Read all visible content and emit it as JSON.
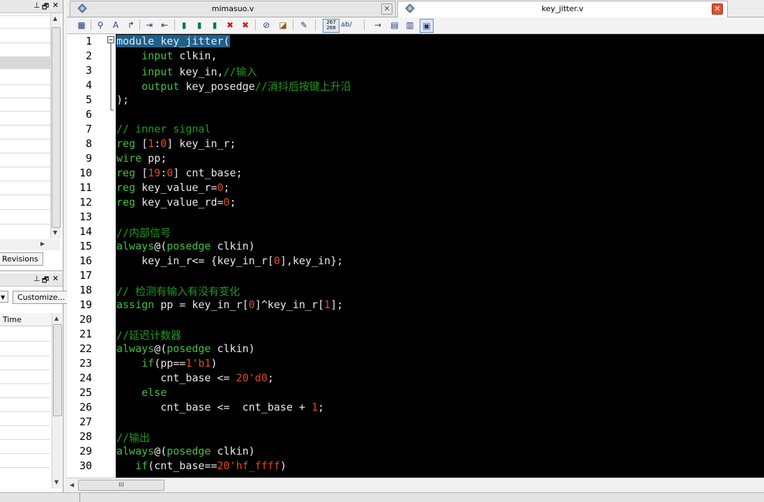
{
  "left_panel": {
    "top_panel_controls": [
      "⊥",
      "🗗",
      "✕"
    ],
    "revisions_tab": "Revisions",
    "mid_panel_controls": [
      "⊥",
      "🗗",
      "✕"
    ],
    "customize_button": "Customize...",
    "time_column": "Time"
  },
  "tabs": [
    {
      "title": "mimasuo.v",
      "active": false
    },
    {
      "title": "key_jitter.v",
      "active": true
    }
  ],
  "toolbar": {
    "tools": [
      "block-icon",
      "binoculars-icon",
      "replace-icon",
      "goto-icon",
      "indent-icon",
      "outdent-icon",
      "bookmark-icon",
      "bookmark-next-icon",
      "bookmark-prev-icon",
      "bookmark-clear-icon",
      "bookmark-clear-all-icon",
      "paperclip-icon",
      "eraser-icon",
      "edit-icon",
      "line-numbers-icon",
      "word-wrap-icon",
      "arrow-right-icon",
      "page-icon",
      "column-icon",
      "view-icon"
    ],
    "line_numbers_label": "267\n268",
    "wrap_label": "ab/"
  },
  "editor": {
    "line_numbers": [
      "1",
      "2",
      "3",
      "4",
      "5",
      "6",
      "7",
      "8",
      "9",
      "10",
      "11",
      "12",
      "13",
      "14",
      "15",
      "16",
      "17",
      "18",
      "19",
      "20",
      "21",
      "22",
      "23",
      "24",
      "25",
      "26",
      "27",
      "28",
      "29",
      "30"
    ],
    "lines": [
      [
        [
          "sel",
          "module key_jitter("
        ]
      ],
      [
        [
          "",
          "    "
        ],
        [
          "kw",
          "input"
        ],
        [
          "",
          " clkin,"
        ]
      ],
      [
        [
          "",
          "    "
        ],
        [
          "kw",
          "input"
        ],
        [
          "",
          " key_in,"
        ],
        [
          "cm",
          "//输入"
        ]
      ],
      [
        [
          "",
          "    "
        ],
        [
          "kw",
          "output"
        ],
        [
          "",
          " key_posedge"
        ],
        [
          "cm",
          "//消抖后按键上升沿"
        ]
      ],
      [
        [
          "",
          ");"
        ]
      ],
      [
        [
          "",
          ""
        ]
      ],
      [
        [
          "cm",
          "// inner signal"
        ]
      ],
      [
        [
          "kw",
          "reg"
        ],
        [
          "",
          " ["
        ],
        [
          "nm",
          "1"
        ],
        [
          "",
          ":"
        ],
        [
          "nm",
          "0"
        ],
        [
          "",
          "] key_in_r;"
        ]
      ],
      [
        [
          "kw",
          "wire"
        ],
        [
          "",
          " pp;"
        ]
      ],
      [
        [
          "kw",
          "reg"
        ],
        [
          "",
          " ["
        ],
        [
          "nm",
          "19"
        ],
        [
          "",
          ":"
        ],
        [
          "nm",
          "0"
        ],
        [
          "",
          "] cnt_base;"
        ]
      ],
      [
        [
          "kw",
          "reg"
        ],
        [
          "",
          " key_value_r="
        ],
        [
          "nm",
          "0"
        ],
        [
          "",
          ";"
        ]
      ],
      [
        [
          "kw",
          "reg"
        ],
        [
          "",
          " key_value_rd="
        ],
        [
          "nm",
          "0"
        ],
        [
          "",
          ";"
        ]
      ],
      [
        [
          "",
          ""
        ]
      ],
      [
        [
          "cm",
          "//内部信号"
        ]
      ],
      [
        [
          "kw",
          "always"
        ],
        [
          "",
          "@("
        ],
        [
          "kw",
          "posedge"
        ],
        [
          "",
          " clkin)"
        ]
      ],
      [
        [
          "",
          "    key_in_r<= {key_in_r["
        ],
        [
          "nm",
          "0"
        ],
        [
          "",
          "],key_in};"
        ]
      ],
      [
        [
          "",
          ""
        ]
      ],
      [
        [
          "cm",
          "// 检测有输入有没有变化"
        ]
      ],
      [
        [
          "kw",
          "assign"
        ],
        [
          "",
          " pp = key_in_r["
        ],
        [
          "nm",
          "0"
        ],
        [
          "",
          "]^key_in_r["
        ],
        [
          "nm",
          "1"
        ],
        [
          "",
          "];"
        ]
      ],
      [
        [
          "",
          ""
        ]
      ],
      [
        [
          "cm",
          "//延迟计数器"
        ]
      ],
      [
        [
          "kw",
          "always"
        ],
        [
          "",
          "@("
        ],
        [
          "kw",
          "posedge"
        ],
        [
          "",
          " clkin)"
        ]
      ],
      [
        [
          "",
          "    "
        ],
        [
          "kw",
          "if"
        ],
        [
          "",
          "(pp=="
        ],
        [
          "nm",
          "1'b1"
        ],
        [
          "",
          ")"
        ]
      ],
      [
        [
          "",
          "       cnt_base <= "
        ],
        [
          "nm",
          "20'd0"
        ],
        [
          "",
          ";"
        ]
      ],
      [
        [
          "",
          "    "
        ],
        [
          "kw",
          "else"
        ]
      ],
      [
        [
          "",
          "       cnt_base <=  cnt_base + "
        ],
        [
          "nm",
          "1"
        ],
        [
          "",
          ";"
        ]
      ],
      [
        [
          "",
          ""
        ]
      ],
      [
        [
          "cm",
          "//输出"
        ]
      ],
      [
        [
          "kw",
          "always"
        ],
        [
          "",
          "@("
        ],
        [
          "kw",
          "posedge"
        ],
        [
          "",
          " clkin)"
        ]
      ],
      [
        [
          "",
          "   "
        ],
        [
          "kw",
          "if"
        ],
        [
          "",
          "(cnt_base=="
        ],
        [
          "nm",
          "20'hf_ffff"
        ],
        [
          "",
          ")"
        ]
      ]
    ]
  },
  "hscroll_label": "III",
  "colors": {
    "keyword": "#40c040",
    "comment": "#1f9a1f",
    "number": "#e04a1a",
    "selection": "#1f5f8c",
    "background": "#000000"
  }
}
